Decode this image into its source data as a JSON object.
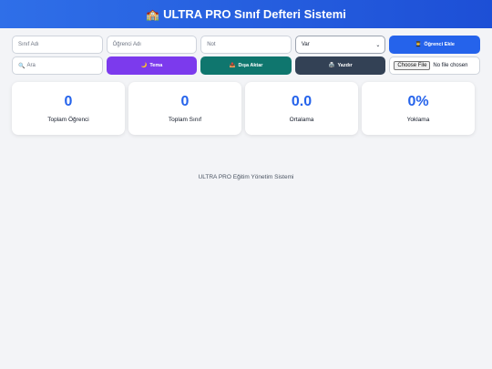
{
  "header": {
    "logo_icon": "🏫",
    "title": "ULTRA PRO Sınıf Defteri Sistemi"
  },
  "form": {
    "class_placeholder": "Sınıf Adı",
    "student_placeholder": "Öğrenci Adı",
    "grade_placeholder": "Not",
    "attendance_selected": "Var",
    "add_icon": "👨‍🎓",
    "add_label": "Öğrenci Ekle"
  },
  "toolbar": {
    "search_icon": "🔍",
    "search_placeholder": "Ara",
    "theme_icon": "🌙",
    "theme_label": "Tema",
    "export_icon": "📤",
    "export_label": "Dışa Aktar",
    "print_icon": "🖨️",
    "print_label": "Yazdır",
    "file_button": "Choose File",
    "file_status": "No file chosen"
  },
  "stats": [
    {
      "value": "0",
      "label": "Toplam Öğrenci"
    },
    {
      "value": "0",
      "label": "Toplam Sınıf"
    },
    {
      "value": "0.0",
      "label": "Ortalama"
    },
    {
      "value": "0%",
      "label": "Yoklama"
    }
  ],
  "footer": {
    "text": "ULTRA PRO Eğitim Yönetim Sistemi"
  },
  "colors": {
    "accent": "#2563eb",
    "theme": "#7c3aed",
    "export": "#0f766e",
    "print": "#334155"
  }
}
